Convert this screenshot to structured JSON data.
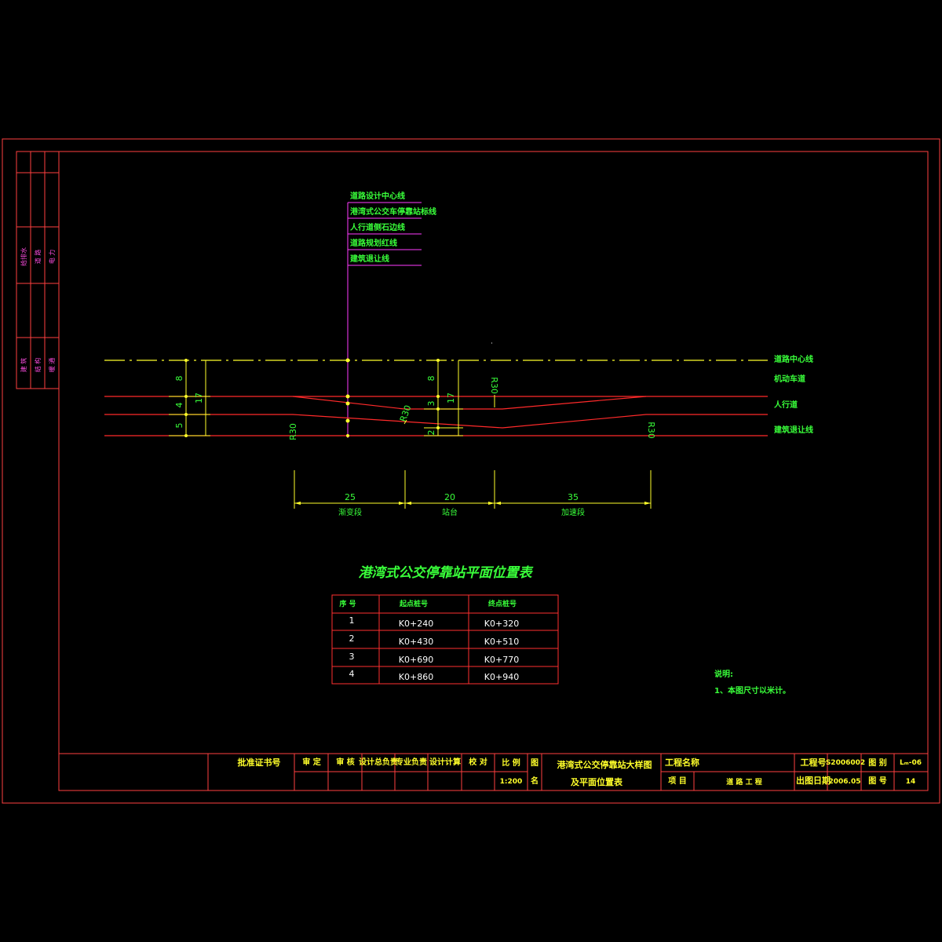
{
  "legend_labels": [
    "道路设计中心线",
    "港湾式公交车停靠站标线",
    "人行道侧石边线",
    "道路规划红线",
    "建筑退让线"
  ],
  "right_labels": [
    "道路中心线",
    "机动车道",
    "人行道",
    "建筑退让线"
  ],
  "dimensions": {
    "left_8": "8",
    "left_4": "4",
    "left_5": "5",
    "left_17": "17",
    "mid_8": "8",
    "mid_3": "3",
    "mid_2": "2",
    "mid_17": "17",
    "r30_a": "R30",
    "r30_b": "R30",
    "r30_c": "R30",
    "r30_d": "R30",
    "bottom_25": "25",
    "bottom_20": "20",
    "bottom_35": "35",
    "seg_1": "渐变段",
    "seg_2": "站台",
    "seg_3": "加速段"
  },
  "table": {
    "title": "港湾式公交停靠站平面位置表",
    "headers": [
      "序 号",
      "起点桩号",
      "终点桩号"
    ],
    "rows": [
      [
        "1",
        "K0+240",
        "K0+320"
      ],
      [
        "2",
        "K0+430",
        "K0+510"
      ],
      [
        "3",
        "K0+690",
        "K0+770"
      ],
      [
        "4",
        "K0+860",
        "K0+940"
      ]
    ]
  },
  "notes": {
    "title": "说明:",
    "line1": "1、本图尺寸以米计。"
  },
  "side_strip": {
    "row1": [
      "给排水",
      "道 路",
      "电 力"
    ],
    "row2": [
      "建 筑",
      "结 构",
      "暖 通"
    ]
  },
  "title_block": {
    "cert_label": "批准证书号",
    "roles": [
      "审 定",
      "审 核",
      "设计总负责",
      "专业负责",
      "设计计算",
      "校 对"
    ],
    "scale_label": "比 例",
    "scale_value": "1:200",
    "drawing_label_top": "图",
    "drawing_label_bottom": "名",
    "drawing_name_line1": "港湾式公交停靠站大样图",
    "drawing_name_line2": "及平面位置表",
    "project_name_label": "工程名称",
    "item_label": "项 目",
    "item_value": "道 路 工 程",
    "project_no_label": "工程号",
    "project_no_value": "S2006002",
    "date_label": "出图日期",
    "date_value": "2006.05",
    "category_label": "图 别",
    "category_value": "Lₘ-06",
    "sheet_label": "图 号",
    "sheet_value": "14"
  }
}
